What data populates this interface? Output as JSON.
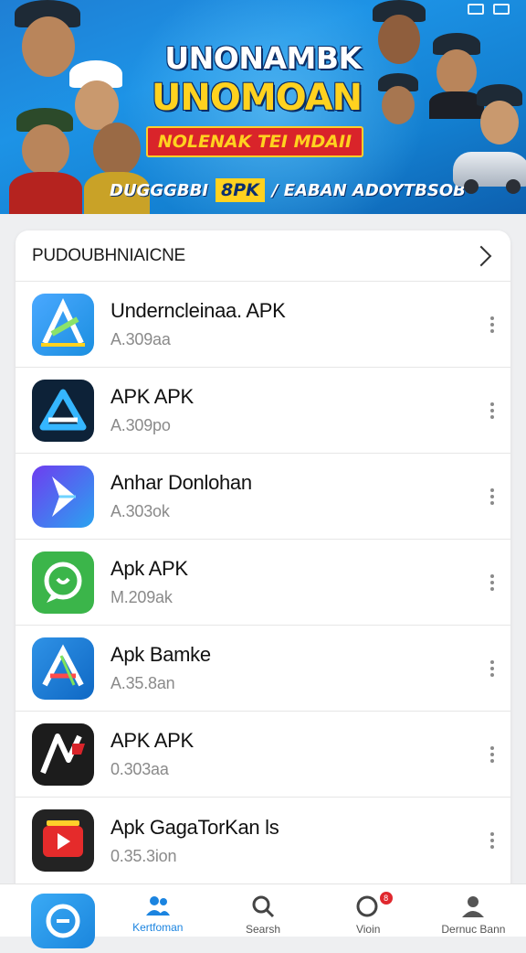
{
  "banner": {
    "title_line1": "UNONAMBK",
    "title_line2": "UNOMOAN",
    "red_ribbon": "NOLENAK TEI MDAII",
    "strip_left": "DUGGGBBI",
    "strip_highlight": "8PK",
    "strip_right": "/ EABAN ADOYTBSOB"
  },
  "section": {
    "title": "PUDOUBHNIAICNE"
  },
  "apps": [
    {
      "name": "Underncleinaa. APK",
      "sub": "A.309aa",
      "icon": "play-store-icon"
    },
    {
      "name": "APK APK",
      "sub": "A.309po",
      "icon": "app-store-a-icon"
    },
    {
      "name": "Anhar Donlohan",
      "sub": "A.303ok",
      "icon": "paper-plane-icon"
    },
    {
      "name": "Apk APK",
      "sub": "M.209ak",
      "icon": "chat-bubble-icon"
    },
    {
      "name": "Apk Bamke",
      "sub": "A.35.8an",
      "icon": "store-a-icon"
    },
    {
      "name": "APK APK",
      "sub": "0.303aa",
      "icon": "warrior-logo-icon"
    },
    {
      "name": "Apk GagaTorKan ls",
      "sub": "0.35.3ion",
      "icon": "video-play-icon"
    }
  ],
  "nav": {
    "items": [
      {
        "label": "",
        "icon": "home-tile-icon"
      },
      {
        "label": "Kertfoman",
        "icon": "users-icon"
      },
      {
        "label": "Searsh",
        "icon": "search-icon"
      },
      {
        "label": "Vioin",
        "icon": "notification-icon"
      },
      {
        "label": "Dernuc Bann",
        "icon": "profile-icon"
      }
    ],
    "accent": "#1b84e0",
    "badge_count": "8"
  }
}
